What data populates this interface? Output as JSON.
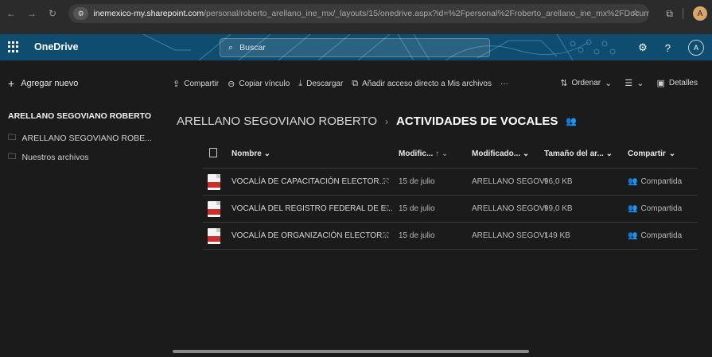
{
  "browser": {
    "url_host": "inemexico-my.sharepoint.com",
    "url_path": "/personal/roberto_arellano_ine_mx/_layouts/15/onedrive.aspx?id=%2Fpersonal%2Froberto_arellano_ine_mx%2FDocume...",
    "profile_initial": "A"
  },
  "suitebar": {
    "app_name": "OneDrive",
    "search_placeholder": "Buscar",
    "avatar_initial": "A",
    "accent": "#0f4d70"
  },
  "leftnav": {
    "add_new": "Agregar nuevo",
    "owner": "ARELLANO SEGOVIANO ROBERTO",
    "items": [
      {
        "label": "ARELLANO SEGOVIANO ROBE..."
      },
      {
        "label": "Nuestros archivos"
      }
    ]
  },
  "commandbar": {
    "share": "Compartir",
    "copy_link": "Copiar vínculo",
    "download": "Descargar",
    "add_shortcut": "Añadir acceso directo a Mis archivos",
    "more": "···",
    "sort": "Ordenar",
    "view": "",
    "details": "Detalles"
  },
  "breadcrumb": {
    "parent": "ARELLANO SEGOVIANO ROBERTO",
    "current": "ACTIVIDADES DE VOCALES"
  },
  "columns": {
    "name": "Nombre",
    "modified": "Modific...",
    "modified_by": "Modificado...",
    "size": "Tamaño del ar...",
    "sharing": "Compartir"
  },
  "files": [
    {
      "name": "VOCALÍA DE CAPACITACIÓN ELECTOR...",
      "modified": "15 de julio",
      "modified_by": "ARELLANO SEGOVI",
      "size": "96,0 KB",
      "sharing": "Compartida"
    },
    {
      "name": "VOCALÍA DEL REGISTRO FEDERAL DE E...",
      "modified": "15 de julio",
      "modified_by": "ARELLANO SEGOVI",
      "size": "99,0 KB",
      "sharing": "Compartida"
    },
    {
      "name": "VOCALÍA DE ORGANIZACIÓN ELECTOR...",
      "modified": "15 de julio",
      "modified_by": "ARELLANO SEGOVI",
      "size": "149 KB",
      "sharing": "Compartida"
    }
  ]
}
